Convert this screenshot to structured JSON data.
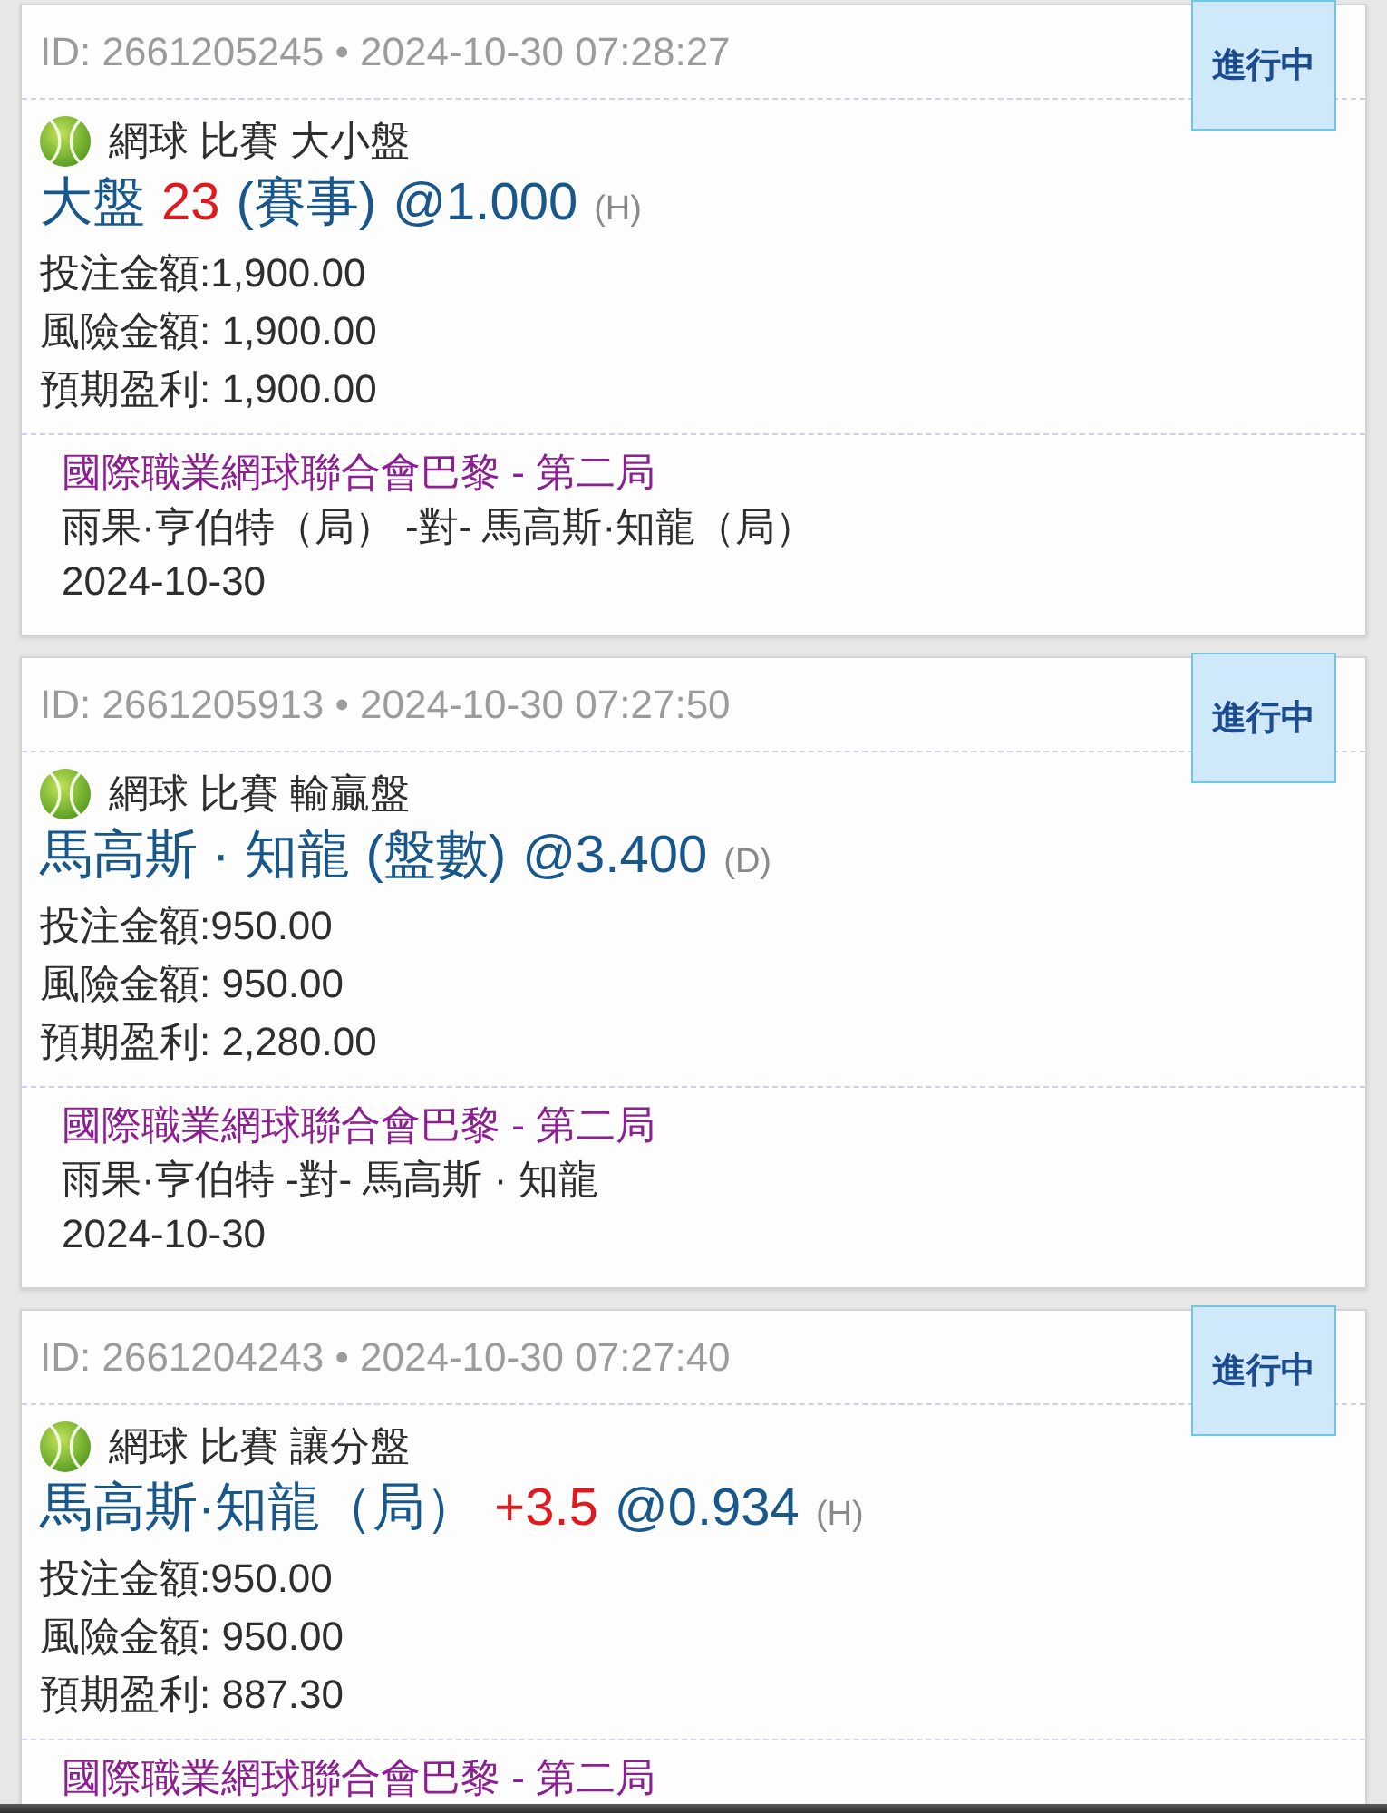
{
  "bets": [
    {
      "id_line": "ID: 2661205245 • 2024-10-30 07:28:27",
      "status": "進行中",
      "category": "網球 比賽 大小盤",
      "selection": {
        "pick": "大盤",
        "line": "23",
        "period": "(賽事)",
        "odds": "@1.000",
        "side": "(H)"
      },
      "amounts": [
        "投注金額:1,900.00",
        "風險金額: 1,900.00",
        "預期盈利: 1,900.00"
      ],
      "league": "國際職業網球聯合會巴黎 - 第二局",
      "matchup": "雨果·亨伯特（局） -對- 馬高斯·知龍（局）",
      "date": "2024-10-30"
    },
    {
      "id_line": "ID: 2661205913 • 2024-10-30 07:27:50",
      "status": "進行中",
      "category": "網球 比賽 輸贏盤",
      "selection": {
        "pick": "馬高斯 · 知龍",
        "period": "(盤數)",
        "odds": "@3.400",
        "side": "(D)"
      },
      "amounts": [
        "投注金額:950.00",
        "風險金額: 950.00",
        "預期盈利: 2,280.00"
      ],
      "league": "國際職業網球聯合會巴黎 - 第二局",
      "matchup": "雨果·亨伯特 -對- 馬高斯 · 知龍",
      "date": "2024-10-30"
    },
    {
      "id_line": "ID: 2661204243 • 2024-10-30 07:27:40",
      "status": "進行中",
      "category": "網球 比賽 讓分盤",
      "selection": {
        "pick": "馬高斯·知龍（局）",
        "line": "+3.5",
        "odds": "@0.934",
        "side": "(H)"
      },
      "amounts": [
        "投注金額:950.00",
        "風險金額: 950.00",
        "預期盈利: 887.30"
      ],
      "league": "國際職業網球聯合會巴黎 - 第二局"
    }
  ]
}
